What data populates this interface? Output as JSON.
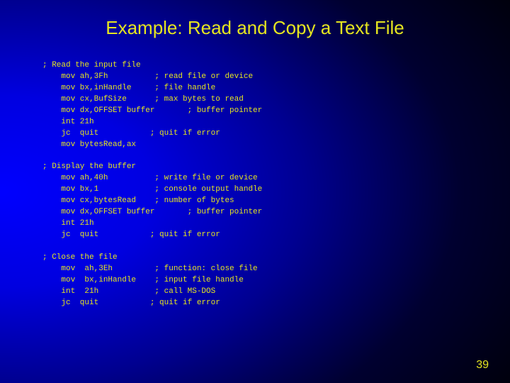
{
  "title": "Example: Read and Copy a Text File",
  "page_number": "39",
  "code": {
    "block1_comment": "; Read the input file",
    "l1": "    mov ah,3Fh          ; read file or device",
    "l2": "    mov bx,inHandle     ; file handle",
    "l3": "    mov cx,BufSize      ; max bytes to read",
    "l4": "    mov dx,OFFSET buffer       ; buffer pointer",
    "l5": "    int 21h",
    "l6": "    jc  quit           ; quit if error",
    "l7": "    mov bytesRead,ax",
    "block2_comment": "; Display the buffer",
    "l8": "    mov ah,40h          ; write file or device",
    "l9": "    mov bx,1            ; console output handle",
    "l10": "    mov cx,bytesRead    ; number of bytes",
    "l11": "    mov dx,OFFSET buffer       ; buffer pointer",
    "l12": "    int 21h",
    "l13": "    jc  quit           ; quit if error",
    "block3_comment": "; Close the file",
    "l14": "    mov  ah,3Eh         ; function: close file",
    "l15": "    mov  bx,inHandle    ; input file handle",
    "l16": "    int  21h            ; call MS-DOS",
    "l17": "    jc  quit           ; quit if error"
  }
}
